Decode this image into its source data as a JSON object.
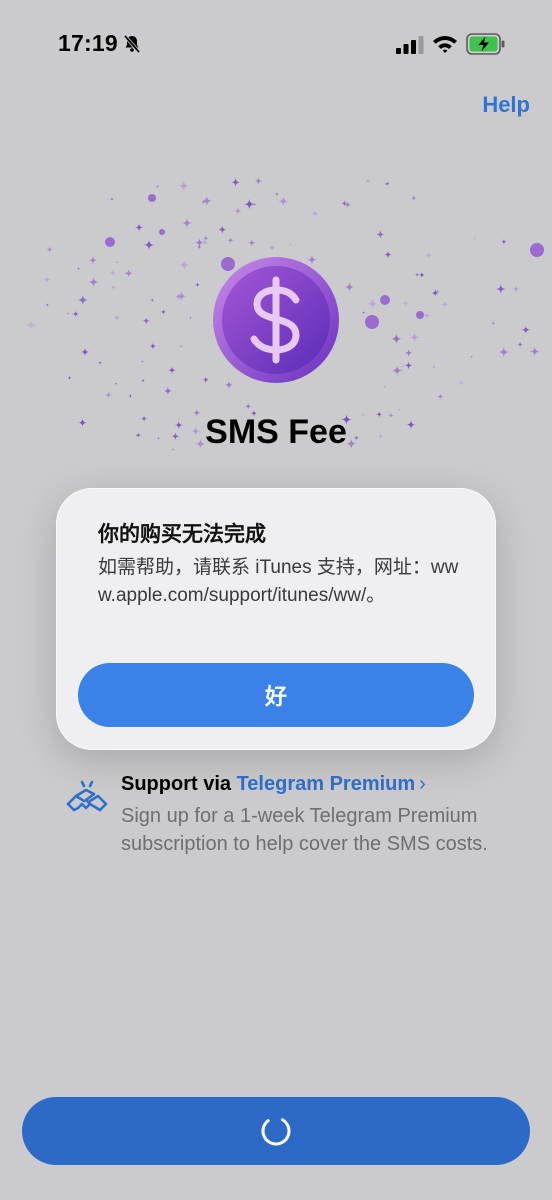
{
  "status_bar": {
    "time": "17:19",
    "icons": [
      "bell-slash-icon",
      "cellular-signal-icon",
      "wifi-icon",
      "battery-charging-icon"
    ]
  },
  "header": {
    "help_label": "Help"
  },
  "hero": {
    "icon": "dollar-coin-icon",
    "title": "SMS Fee"
  },
  "alert": {
    "title": "你的购买无法完成",
    "message": "如需帮助，请联系 iTunes 支持，网址：www.apple.com/support/itunes/ww/。",
    "ok_label": "好"
  },
  "support": {
    "icon": "handshake-icon",
    "prefix": "Support via ",
    "link_text": "Telegram Premium",
    "chevron": "›",
    "description": "Sign up for a 1-week Telegram Premium subscription to help cover the SMS costs."
  },
  "bottom_button": {
    "icon": "loading-spinner-icon",
    "state": "loading"
  },
  "colors": {
    "background": "#cbcbcd",
    "accent": "#3a82e8",
    "link": "#2f6fcc",
    "coin_purple": "#8a4bd1"
  }
}
